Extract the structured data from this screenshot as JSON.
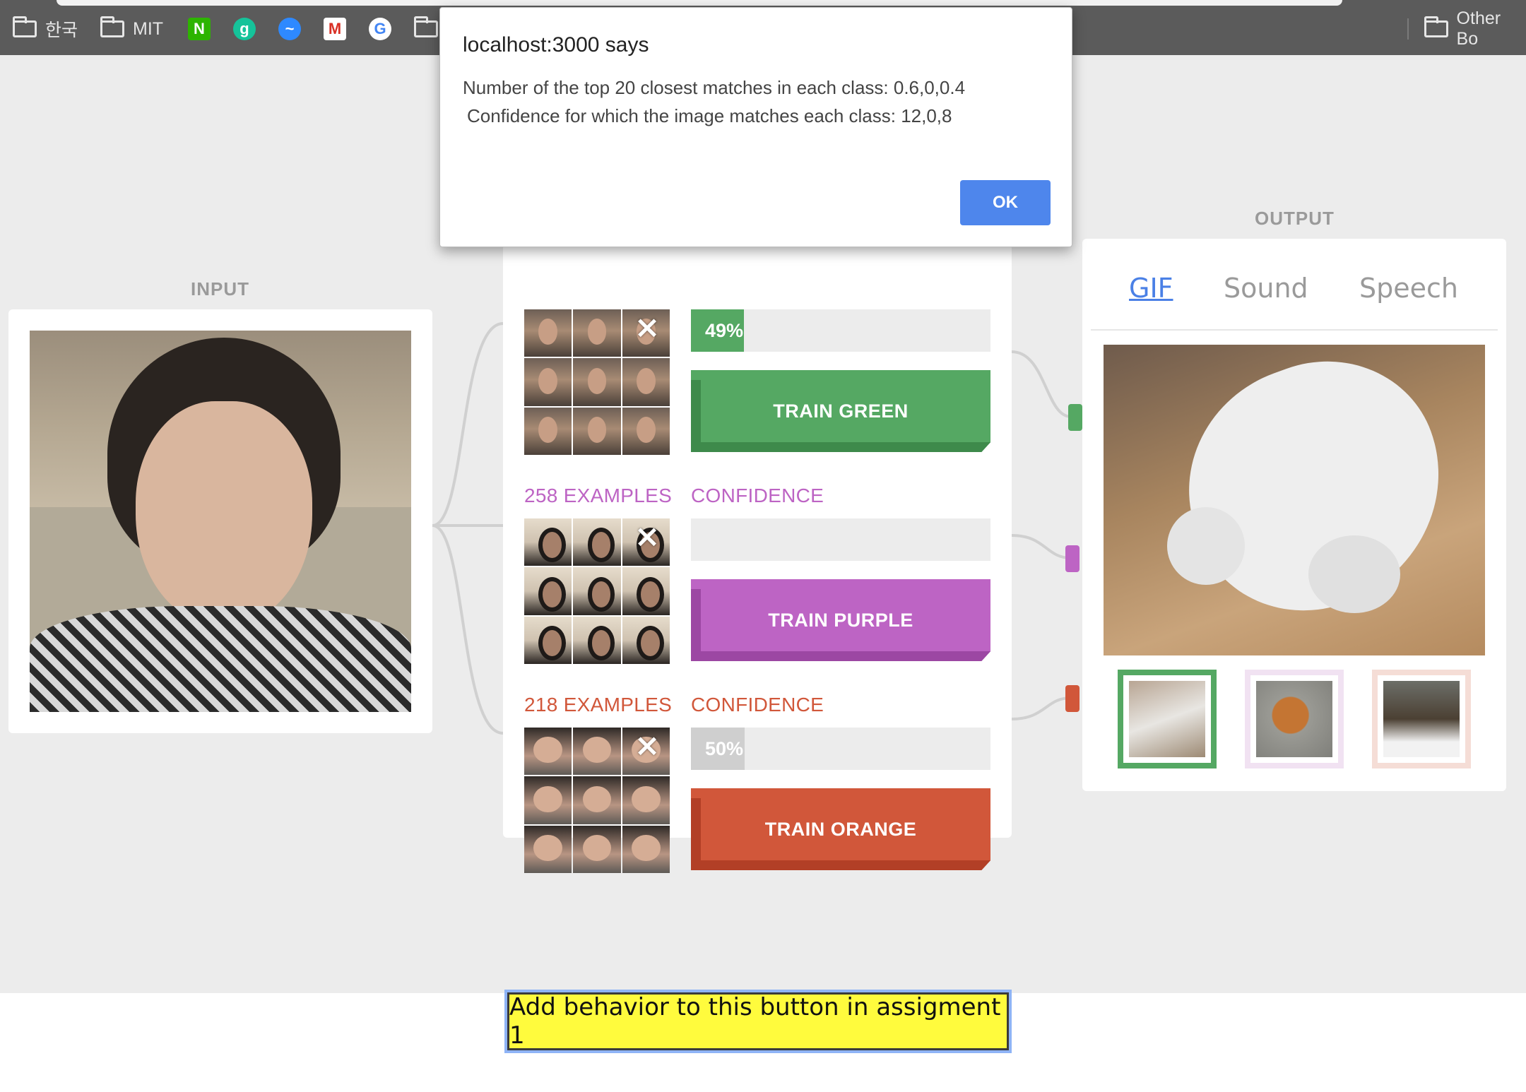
{
  "bookmarks": {
    "items": [
      {
        "label": "한국",
        "icon": "folder-icon"
      },
      {
        "label": "MIT",
        "icon": "folder-icon"
      },
      {
        "label": "",
        "icon": "naver-icon",
        "glyph": "N",
        "color": "#2db400"
      },
      {
        "label": "",
        "icon": "grammarly-icon",
        "glyph": "g",
        "color": "#15c39a"
      },
      {
        "label": "",
        "icon": "messenger-icon",
        "glyph": "~",
        "color": "#2e89ff"
      },
      {
        "label": "",
        "icon": "gmail-icon",
        "glyph": "M",
        "color": "#d93025"
      },
      {
        "label": "",
        "icon": "google-icon",
        "glyph": "G",
        "color": "#4285f4"
      },
      {
        "label": "",
        "icon": "folder-icon"
      }
    ],
    "other": "Other Bo"
  },
  "input": {
    "label": "INPUT"
  },
  "output": {
    "label": "OUTPUT",
    "tabs": [
      "GIF",
      "Sound",
      "Speech"
    ],
    "active_tab": "GIF"
  },
  "classes": [
    {
      "name": "green",
      "examples": "",
      "confidence_label": "",
      "confidence": "49%",
      "confidence_value": 0.49,
      "button": "TRAIN GREEN",
      "color": "#55a863",
      "dark": "#3e8a4b"
    },
    {
      "name": "purple",
      "examples": "258 EXAMPLES",
      "confidence_label": "CONFIDENCE",
      "confidence": "",
      "confidence_value": 0,
      "button": "TRAIN PURPLE",
      "color": "#bd64c4",
      "dark": "#9c47a3"
    },
    {
      "name": "orange",
      "examples": "218 EXAMPLES",
      "confidence_label": "CONFIDENCE",
      "confidence": "50%",
      "confidence_value": 0.5,
      "button": "TRAIN ORANGE",
      "color": "#d1573a",
      "dark": "#b23f26"
    }
  ],
  "assignment_button": "Add behavior to this button in assigment 1",
  "dialog": {
    "title": "localhost:3000 says",
    "line1": "Number of the top 20 closest matches in each class: 0.6,0,0.4",
    "line2": "Confidence for which the image matches each class: 12,0,8",
    "ok": "OK"
  }
}
